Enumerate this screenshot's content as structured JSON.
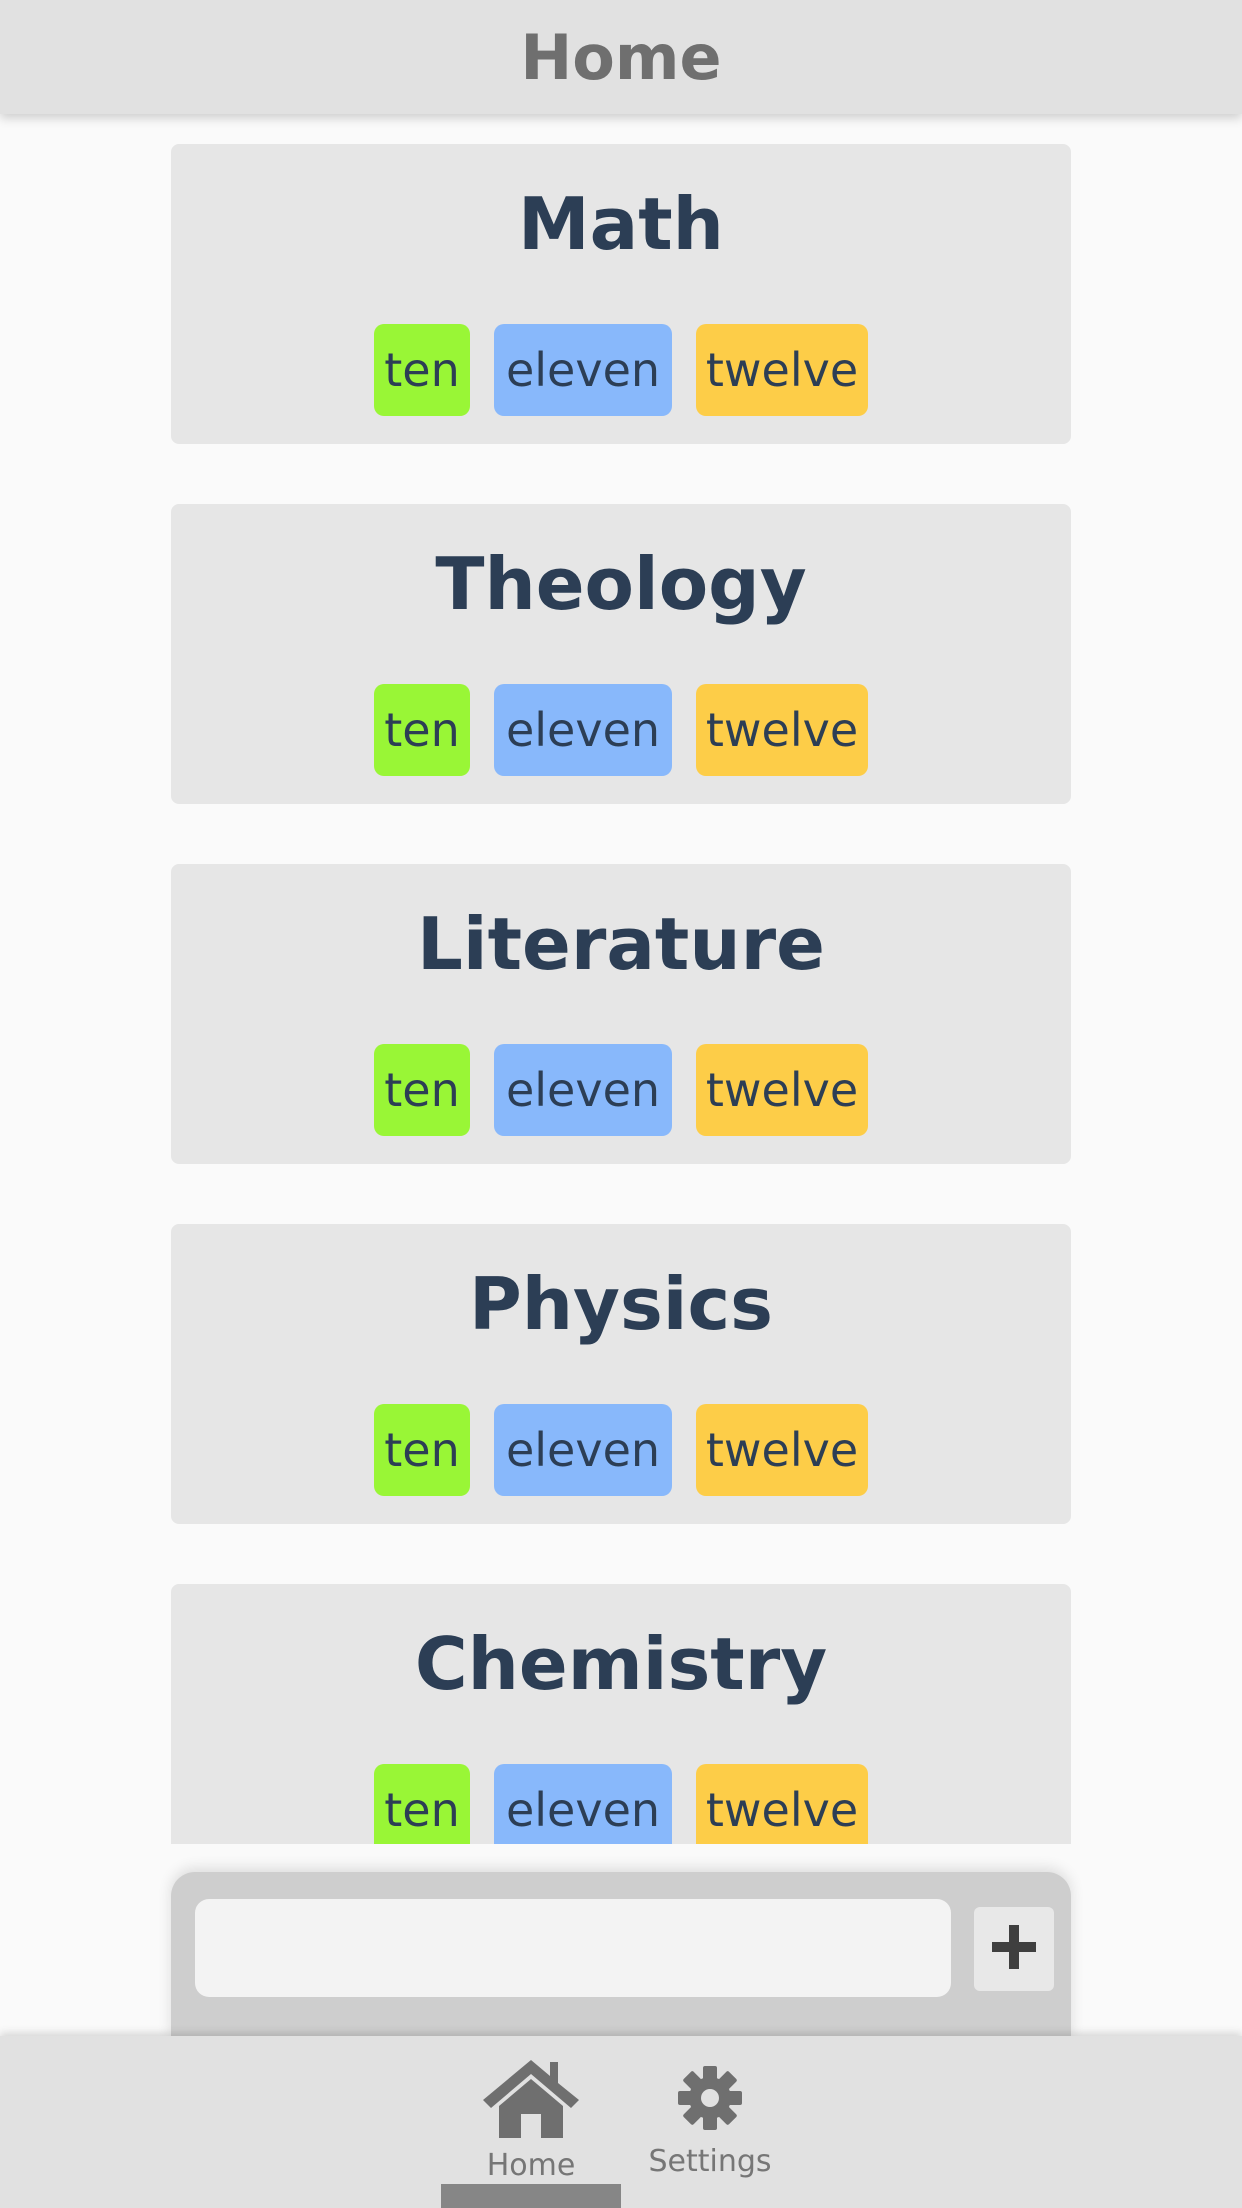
{
  "header": {
    "title": "Home"
  },
  "colors": {
    "ten": "#99f636",
    "eleven": "#88b8fb",
    "twelve": "#fdcd48"
  },
  "subjects": [
    {
      "title": "Math",
      "tags": [
        "ten",
        "eleven",
        "twelve"
      ]
    },
    {
      "title": "Theology",
      "tags": [
        "ten",
        "eleven",
        "twelve"
      ]
    },
    {
      "title": "Literature",
      "tags": [
        "ten",
        "eleven",
        "twelve"
      ]
    },
    {
      "title": "Physics",
      "tags": [
        "ten",
        "eleven",
        "twelve"
      ]
    },
    {
      "title": "Chemistry",
      "tags": [
        "ten",
        "eleven",
        "twelve"
      ]
    }
  ],
  "input": {
    "value": "",
    "placeholder": ""
  },
  "add_button": {
    "icon": "plus-icon"
  },
  "nav": {
    "items": [
      {
        "label": "Home",
        "icon": "home-icon",
        "active": true
      },
      {
        "label": "Settings",
        "icon": "gear-icon",
        "active": false
      }
    ]
  }
}
